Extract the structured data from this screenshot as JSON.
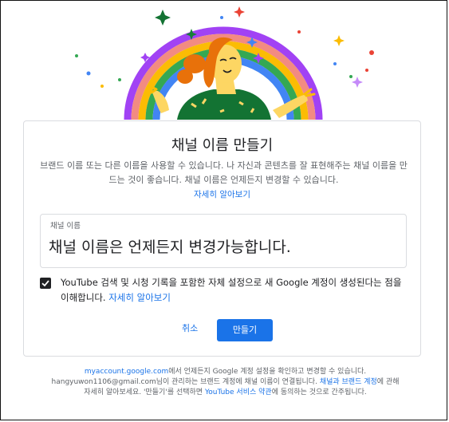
{
  "dialog": {
    "title": "채널 이름 만들기",
    "description": "브랜드 이름 또는 다른 이름을 사용할 수 있습니다. 나 자신과 콘텐츠를 잘 표현해주는 채널 이름을 만드는 것이 좋습니다. 채널 이름은 언제든지 변경할 수 있습니다.",
    "learn_more": "자세히 알아보기",
    "field": {
      "label": "채널 이름",
      "value": "채널 이름은 언제든지 변경가능합니다."
    },
    "consent": {
      "checked": true,
      "text": "YouTube 검색 및 시청 기록을 포함한 자체 설정으로 새 Google 계정이 생성된다는 점을 이해합니다.",
      "link": "자세히 알아보기"
    },
    "cancel_label": "취소",
    "create_label": "만들기"
  },
  "footer": {
    "account_link": "myaccount.google.com",
    "line1_rest": "에서 언제든지 Google 계정 설정을 확인하고 변경할 수 있습니다.",
    "line2": "hangyuwon1106@gmail.com님이 관리하는 브랜드 계정에 채널 이름이 연결됩니다.",
    "brand_link": "채널과 브랜드 계정",
    "line3_rest": "에 관해 자세히 알아보세요. '만들기'를 선택하면",
    "terms_link": "YouTube 서비스 약관",
    "line4_rest": "에 동의하는 것으로 간주됩니다."
  },
  "colors": {
    "accent": "#1a73e8",
    "checkbox": "#202124",
    "hair": "#e8710a",
    "shirt": "#137333"
  }
}
